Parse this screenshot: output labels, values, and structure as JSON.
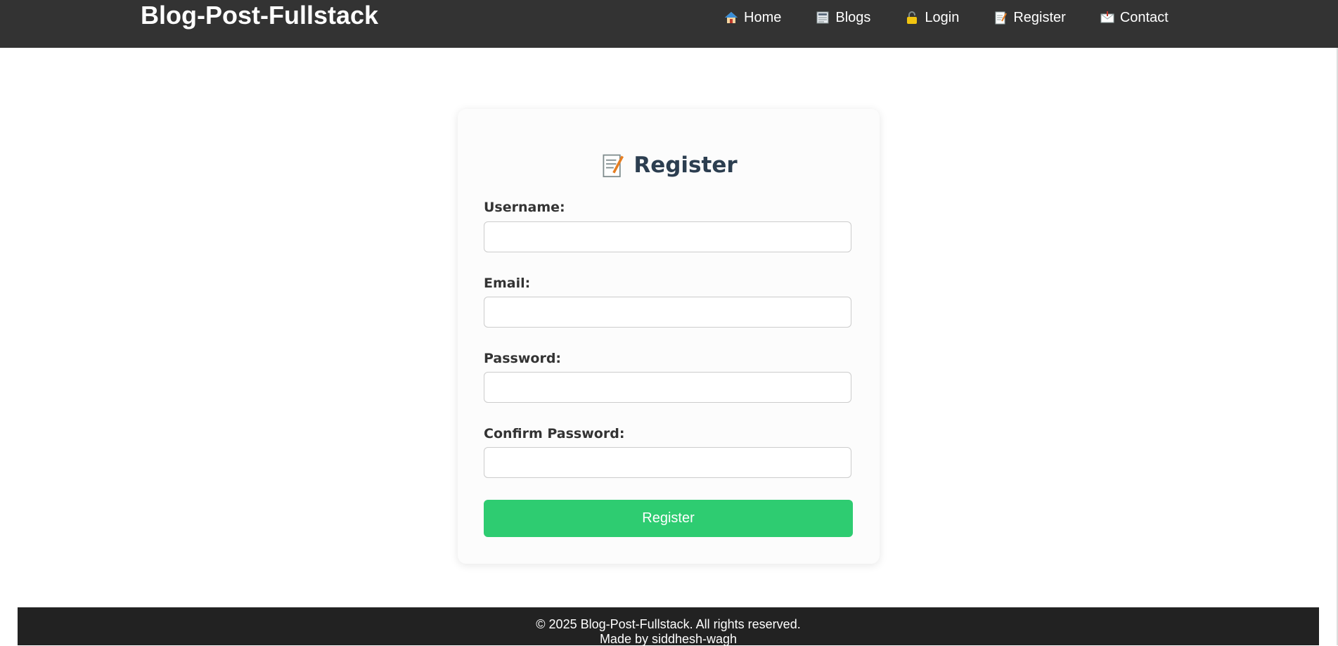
{
  "navbar": {
    "brand": "Blog-Post-Fullstack",
    "links": [
      {
        "label": "Home",
        "icon": "house-icon"
      },
      {
        "label": "Blogs",
        "icon": "newspaper-icon"
      },
      {
        "label": "Login",
        "icon": "lock-icon"
      },
      {
        "label": "Register",
        "icon": "memo-icon"
      },
      {
        "label": "Contact",
        "icon": "envelope-icon"
      }
    ]
  },
  "form": {
    "title": "Register",
    "title_icon": "memo-icon",
    "fields": [
      {
        "label": "Username:",
        "value": "",
        "type": "text"
      },
      {
        "label": "Email:",
        "value": "",
        "type": "email"
      },
      {
        "label": "Password:",
        "value": "",
        "type": "password"
      },
      {
        "label": "Confirm Password:",
        "value": "",
        "type": "password"
      }
    ],
    "submit_label": "Register"
  },
  "footer": {
    "copyright": "© 2025 Blog-Post-Fullstack. All rights reserved.",
    "credit": "Made by siddhesh-wagh"
  },
  "colors": {
    "navbar_bg": "#333333",
    "footer_bg": "#222222",
    "title_text": "#2c3e50",
    "submit_bg": "#2ecc71"
  }
}
